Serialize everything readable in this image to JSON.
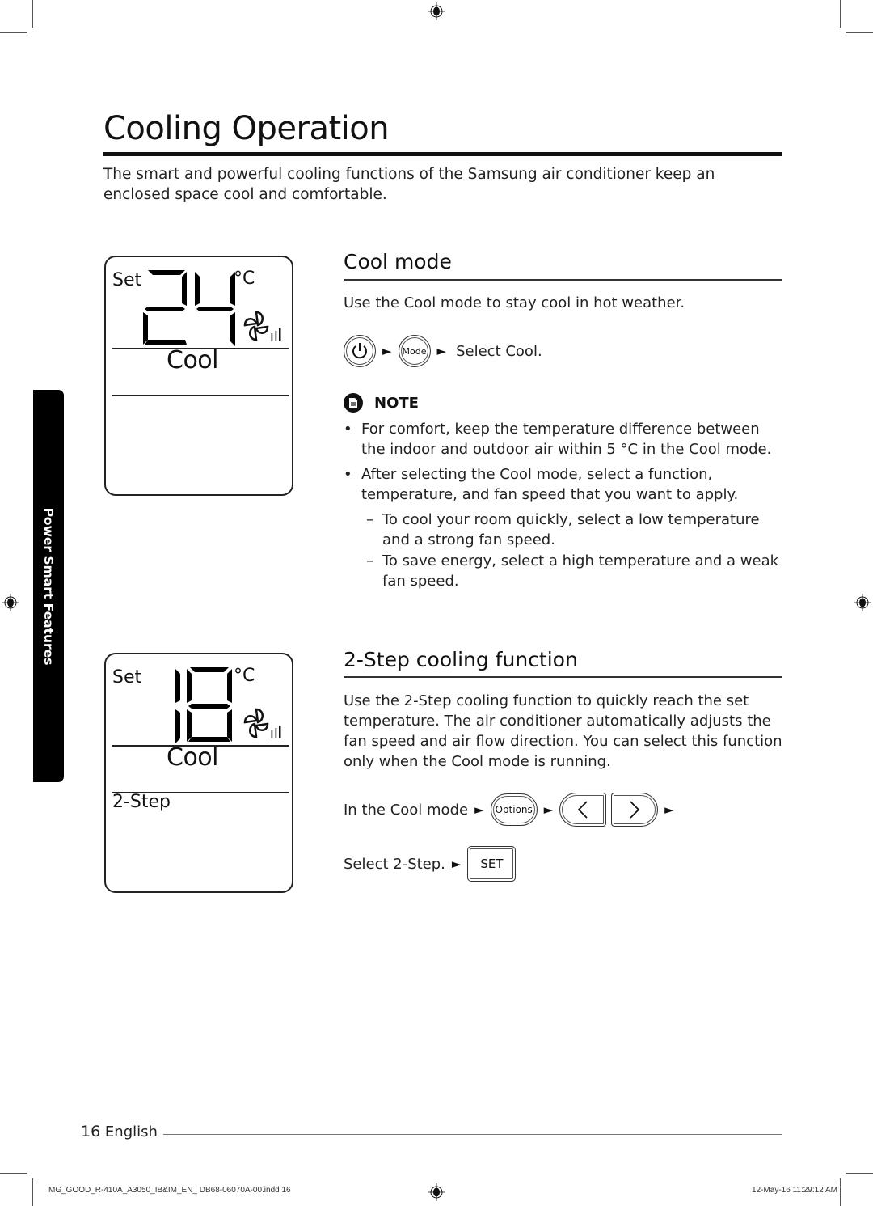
{
  "page": {
    "title": "Cooling Operation",
    "intro": "The smart and powerful cooling functions of the Samsung air conditioner keep an enclosed space cool and comfortable."
  },
  "side_tab": {
    "label": "Power Smart Features"
  },
  "display1": {
    "set_label": "Set",
    "temperature": "24",
    "unit": "°C",
    "mode": "Cool",
    "fan_icon": "fan-icon",
    "extra": ""
  },
  "display2": {
    "set_label": "Set",
    "temperature": "18",
    "unit": "°C",
    "mode": "Cool",
    "fan_icon": "fan-icon",
    "extra": "2-Step"
  },
  "cool_mode": {
    "heading": "Cool mode",
    "description": "Use the Cool mode to stay cool in hot weather.",
    "steps": {
      "power_icon": "power-icon",
      "mode_button": "Mode",
      "arrow": "►",
      "result": "Select Cool."
    },
    "note": {
      "icon": "note-icon",
      "label": "NOTE",
      "items": [
        {
          "bullet": "•",
          "text": "For comfort, keep the temperature difference between the indoor and outdoor air within 5 °C in the Cool mode."
        },
        {
          "bullet": "•",
          "text": "After selecting the Cool mode, select a function, temperature, and fan speed that you want to apply."
        }
      ],
      "sub_items": [
        {
          "dash": "–",
          "text": "To cool your room quickly, select a low temperature and a strong fan speed."
        },
        {
          "dash": "–",
          "text": "To save energy, select a high temperature and a weak fan speed."
        }
      ]
    }
  },
  "two_step": {
    "heading": "2-Step cooling function",
    "description": "Use the 2-Step cooling function to quickly reach the set temperature. The air conditioner automatically adjusts the fan speed and air flow direction. You can select this function only when the Cool mode is running.",
    "line1": {
      "prefix": "In the Cool mode",
      "arrow": "►",
      "options_button": "Options",
      "left_button": "‹",
      "right_button": "›"
    },
    "line2": {
      "prefix": "Select 2-Step.",
      "arrow": "►",
      "set_button": "SET"
    }
  },
  "footer": {
    "page_number": "16",
    "language": "English",
    "slug_left": "MG_GOOD_R-410A_A3050_IB&IM_EN_ DB68-06070A-00.indd   16",
    "slug_right": "12-May-16   11:29:12 AM"
  }
}
